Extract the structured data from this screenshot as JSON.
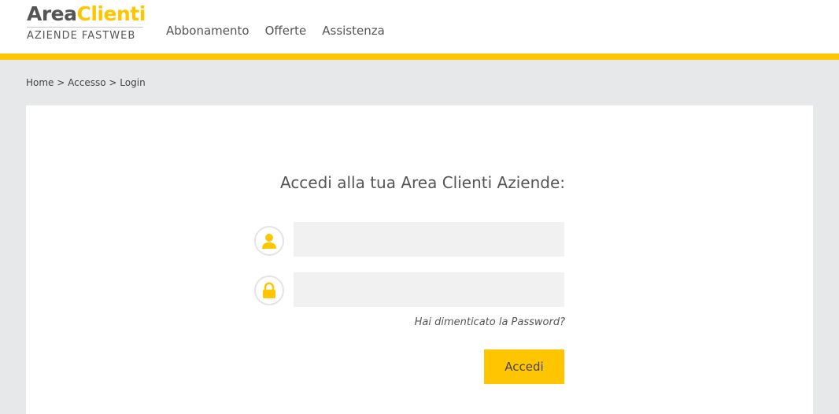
{
  "header": {
    "logo": {
      "part1": "Area",
      "part2": "Clienti",
      "subtitle": "AZIENDE FASTWEB"
    },
    "nav": [
      "Abbonamento",
      "Offerte",
      "Assistenza"
    ]
  },
  "breadcrumb": {
    "items": [
      "Home",
      "Accesso",
      "Login"
    ],
    "separator": ">"
  },
  "login": {
    "title": "Accedi alla tua Area Clienti Aziende:",
    "username_value": "",
    "password_value": "",
    "forgot_label": "Hai dimenticato la Password?",
    "submit_label": "Accedi"
  },
  "icons": {
    "username": "user-icon",
    "password": "lock-icon"
  },
  "colors": {
    "accent": "#ffc600",
    "background": "#e6e8e9",
    "field": "#f1f1f1",
    "text": "#555555"
  }
}
